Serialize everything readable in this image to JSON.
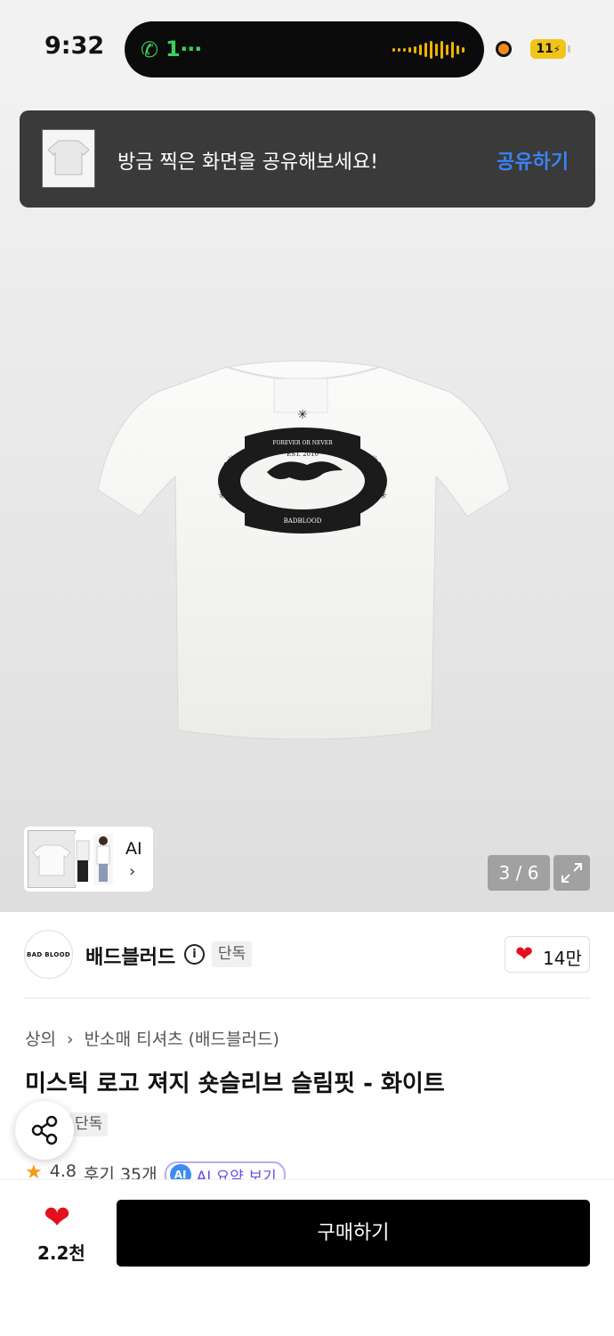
{
  "status_bar": {
    "time": "9:32",
    "call_label": "1⋯",
    "battery": "11"
  },
  "toast": {
    "message": "방금 찍은 화면을 공유해보세요!",
    "action": "공유하기"
  },
  "gallery": {
    "ai_label": "AI",
    "counter": "3 / 6",
    "current_image": 3,
    "total_images": 6
  },
  "brand": {
    "logo_text": "BAD BLOOD",
    "name": "배드블러드",
    "badge": "단독",
    "likes": "14만"
  },
  "product": {
    "breadcrumb": [
      "상의",
      "반소매 티셔츠 (배드블러드)"
    ],
    "title": "미스틱 로고 져지 숏슬리브 슬림핏 - 화이트",
    "badge": "단독",
    "rating": "4.8",
    "reviews": "후기 35개",
    "ai_summary": "AI 요약 보기",
    "ai_badge": "AI"
  },
  "bottom_bar": {
    "likes": "2.2천",
    "buy_label": "구매하기"
  },
  "colors": {
    "accent_blue": "#3b82f6",
    "heart_red": "#e5101d",
    "buy_button": "#000000",
    "call_green": "#3ad15c"
  }
}
